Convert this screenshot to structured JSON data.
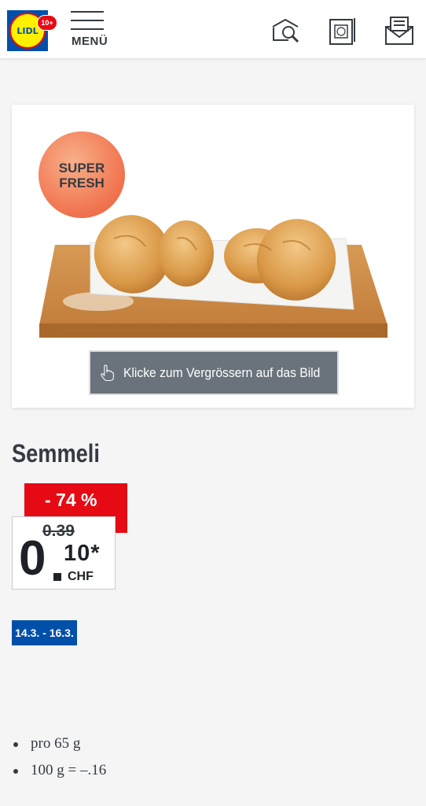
{
  "header": {
    "logo_text": "LIDL",
    "logo_badge": "10+",
    "menu_label": "MENÜ",
    "icons": [
      "product-search-icon",
      "leaflet-icon",
      "newsletter-icon"
    ]
  },
  "product": {
    "image_badge": "SUPER FRESH",
    "zoom_label": "Klicke zum Vergrössern auf das Bild",
    "title": "Semmeli",
    "discount": "- 74 %",
    "old_price": "0.39",
    "price_int": "0",
    "price_dec": "10*",
    "currency": "CHF",
    "date_range": "14.3. - 16.3.",
    "details": [
      "pro 65 g",
      "100 g = –.16"
    ]
  },
  "colors": {
    "brand_blue": "#0050aa",
    "brand_red": "#e60a14",
    "brand_yellow": "#fff000",
    "zoom_button": "#6a737b"
  }
}
